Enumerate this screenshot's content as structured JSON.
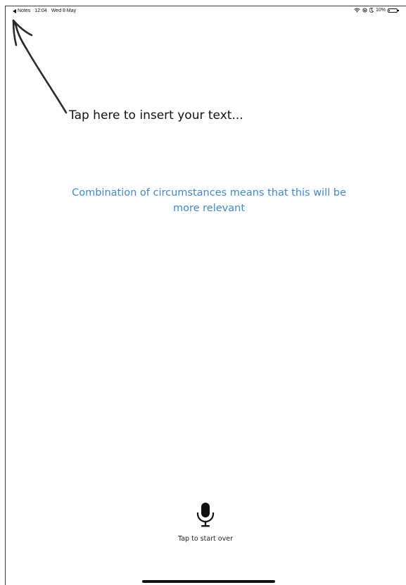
{
  "status_bar": {
    "back_label": "Notes",
    "time": "12:04",
    "date": "Wed 8 May",
    "battery_percent": "10%",
    "battery_level": 0.1,
    "icons": [
      "wifi-icon",
      "orientation-lock-icon",
      "moon-icon",
      "battery-icon"
    ]
  },
  "editor": {
    "insert_text": "Tap here to insert your text..."
  },
  "hint": {
    "text": "Combination of circumstances means that this will be more relevant",
    "color": "#3f88d1"
  },
  "dictation": {
    "icon": "microphone-icon",
    "caption": "Tap to start over"
  }
}
